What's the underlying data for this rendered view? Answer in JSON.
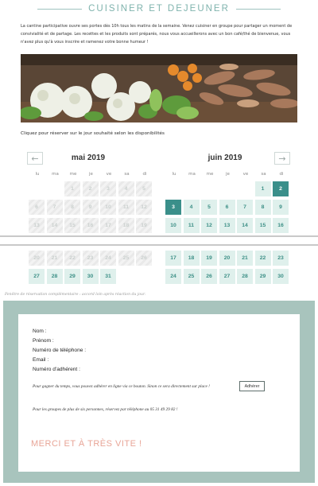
{
  "header": {
    "title": "CUISINER ET DEJEUNER"
  },
  "intro": {
    "text": "La cantine participative ouvre ses portes dès 10h tous les matins de la semaine. Venez cuisiner en groupe pour partager un moment de convivialité et de partage. Les recettes et les produits sont préparés, nous vous accueillerons avec un bon café/thé de bienvenue, vous n'avez plus qu'à vous inscrire et ramenez votre bonne humeur !"
  },
  "photo": {
    "icon": "vegetables-photo"
  },
  "booking": {
    "hint": "Cliquez pour réserver sur le jour souhaité selon les disponibilités"
  },
  "calendar": {
    "prev_icon": "arrow-left-icon",
    "next_icon": "arrow-right-icon",
    "prev_label": "←",
    "next_label": "→",
    "weekday_labels": [
      "lu",
      "ma",
      "me",
      "je",
      "ve",
      "sa",
      "di"
    ],
    "months": [
      {
        "title": "mai 2019",
        "rows": [
          [
            null,
            null,
            "1",
            "2",
            "3",
            "4",
            "5"
          ],
          [
            "6",
            "7",
            "8",
            "9",
            "10",
            "11",
            "12"
          ],
          [
            "13",
            "14",
            "15",
            "16",
            "17",
            "18",
            "19"
          ],
          [
            "20",
            "21",
            "22",
            "23",
            "24",
            "25",
            "26"
          ],
          [
            "27",
            "28",
            "29",
            "30",
            "31",
            null,
            null
          ]
        ],
        "states": [
          [
            null,
            null,
            "d",
            "d",
            "d",
            "d",
            "d"
          ],
          [
            "d",
            "d",
            "d",
            "d",
            "d",
            "d",
            "d"
          ],
          [
            "d",
            "d",
            "d",
            "d",
            "d",
            "d",
            "d"
          ],
          [
            "d",
            "d",
            "d",
            "d",
            "d",
            "d",
            "d"
          ],
          [
            "a",
            "a",
            "a",
            "a",
            "a",
            null,
            null
          ]
        ]
      },
      {
        "title": "juin 2019",
        "rows": [
          [
            null,
            null,
            null,
            null,
            null,
            "1",
            "2"
          ],
          [
            "3",
            "4",
            "5",
            "6",
            "7",
            "8",
            "9"
          ],
          [
            "10",
            "11",
            "12",
            "13",
            "14",
            "15",
            "16"
          ],
          [
            "17",
            "18",
            "19",
            "20",
            "21",
            "22",
            "23"
          ],
          [
            "24",
            "25",
            "26",
            "27",
            "28",
            "29",
            "30"
          ]
        ],
        "states": [
          [
            null,
            null,
            null,
            null,
            null,
            "a",
            "s"
          ],
          [
            "s",
            "a",
            "a",
            "a",
            "a",
            "a",
            "a"
          ],
          [
            "a",
            "a",
            "a",
            "a",
            "a",
            "a",
            "a"
          ],
          [
            "a",
            "a",
            "a",
            "a",
            "a",
            "a",
            "a"
          ],
          [
            "a",
            "a",
            "a",
            "a",
            "a",
            "a",
            "a"
          ]
        ]
      }
    ]
  },
  "footnote": "Fenêtre de réservation complémentaire : accord loin après réaction du jour.",
  "form": {
    "labels": [
      "Nom :",
      "Prénom :",
      "Numéro de téléphone :",
      "Email :",
      "Numéro d'adhérent :"
    ],
    "membership_note": "Pour gagner du temps, vous pouvez adhérer en ligne via ce bouton. Sinon ce sera directement sur place !",
    "membership_button": "Adhérer",
    "groups_note": "Pour les groupes de plus de six personnes, réservez par téléphone au 05 31 49 29 82 !",
    "thanks": "MERCI ET À TRÈS VITE !"
  },
  "colors": {
    "accent": "#3a8f8a",
    "available_bg": "#dff0ec",
    "form_border": "#a8c4bd",
    "thanks": "#e8a597"
  }
}
